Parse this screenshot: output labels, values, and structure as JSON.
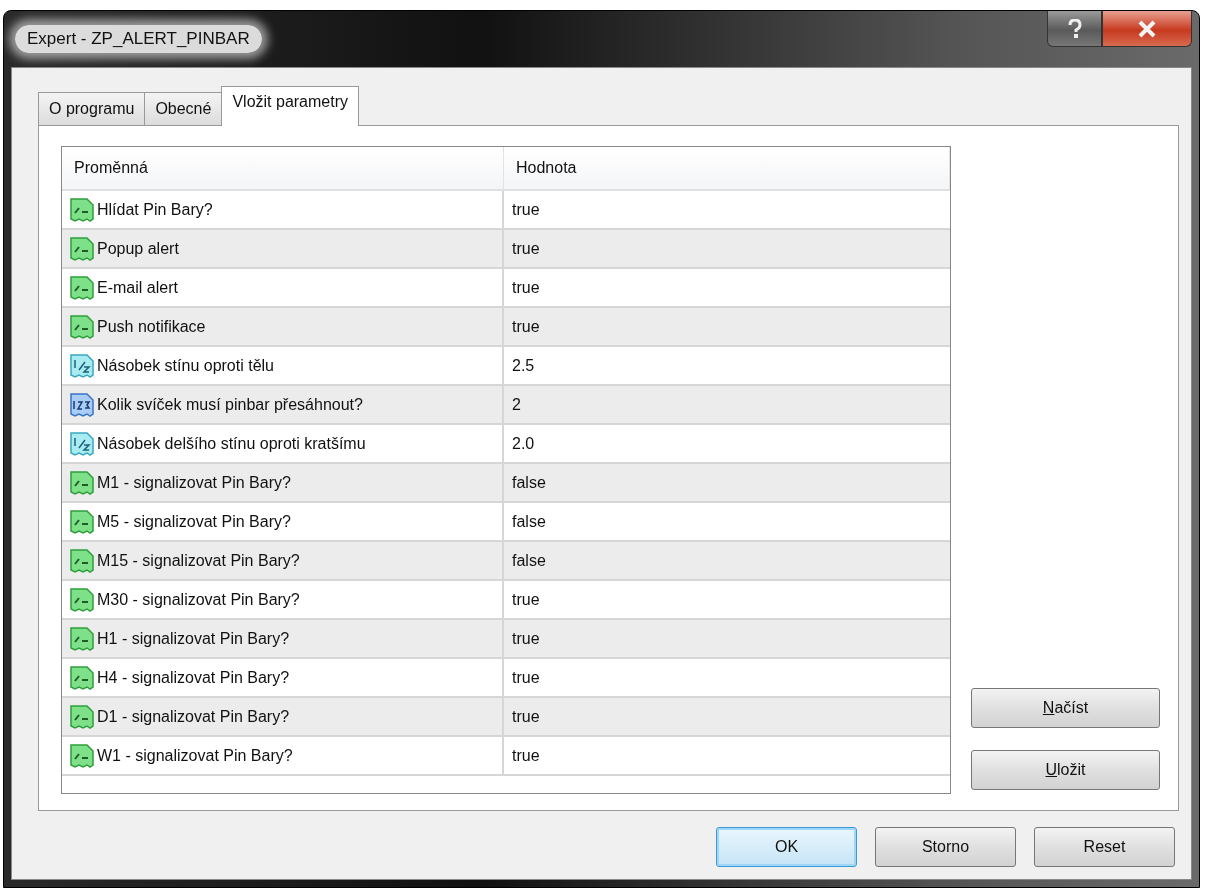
{
  "window": {
    "title": "Expert - ZP_ALERT_PINBAR"
  },
  "tabs": [
    {
      "label": "O programu",
      "selected": false
    },
    {
      "label": "Obecné",
      "selected": false
    },
    {
      "label": "Vložit parametry",
      "selected": true
    }
  ],
  "table": {
    "columns": [
      "Proměnná",
      "Hodnota"
    ],
    "rows": [
      {
        "kind": "bool",
        "name": "Hlídat Pin Bary?",
        "value": "true"
      },
      {
        "kind": "bool",
        "name": "Popup alert",
        "value": "true"
      },
      {
        "kind": "bool",
        "name": "E-mail alert",
        "value": "true"
      },
      {
        "kind": "bool",
        "name": "Push notifikace",
        "value": "true"
      },
      {
        "kind": "double",
        "name": "Násobek stínu oproti tělu",
        "value": "2.5"
      },
      {
        "kind": "int",
        "name": "Kolik svíček musí pinbar přesáhnout?",
        "value": "2"
      },
      {
        "kind": "double",
        "name": "Násobek delšího stínu oproti kratšímu",
        "value": "2.0"
      },
      {
        "kind": "bool",
        "name": "M1 - signalizovat Pin Bary?",
        "value": "false"
      },
      {
        "kind": "bool",
        "name": "M5 - signalizovat Pin Bary?",
        "value": "false"
      },
      {
        "kind": "bool",
        "name": "M15 - signalizovat Pin Bary?",
        "value": "false"
      },
      {
        "kind": "bool",
        "name": "M30 - signalizovat Pin Bary?",
        "value": "true"
      },
      {
        "kind": "bool",
        "name": "H1 - signalizovat Pin Bary?",
        "value": "true"
      },
      {
        "kind": "bool",
        "name": "H4 - signalizovat Pin Bary?",
        "value": "true"
      },
      {
        "kind": "bool",
        "name": "D1 - signalizovat Pin Bary?",
        "value": "true"
      },
      {
        "kind": "bool",
        "name": "W1 - signalizovat Pin Bary?",
        "value": "true"
      }
    ]
  },
  "side_buttons": [
    {
      "label": "Načíst",
      "underline_first": true
    },
    {
      "label": "Uložit",
      "underline_first": true
    }
  ],
  "buttons": [
    {
      "label": "OK",
      "default": true
    },
    {
      "label": "Storno",
      "default": false
    },
    {
      "label": "Reset",
      "default": false
    }
  ]
}
